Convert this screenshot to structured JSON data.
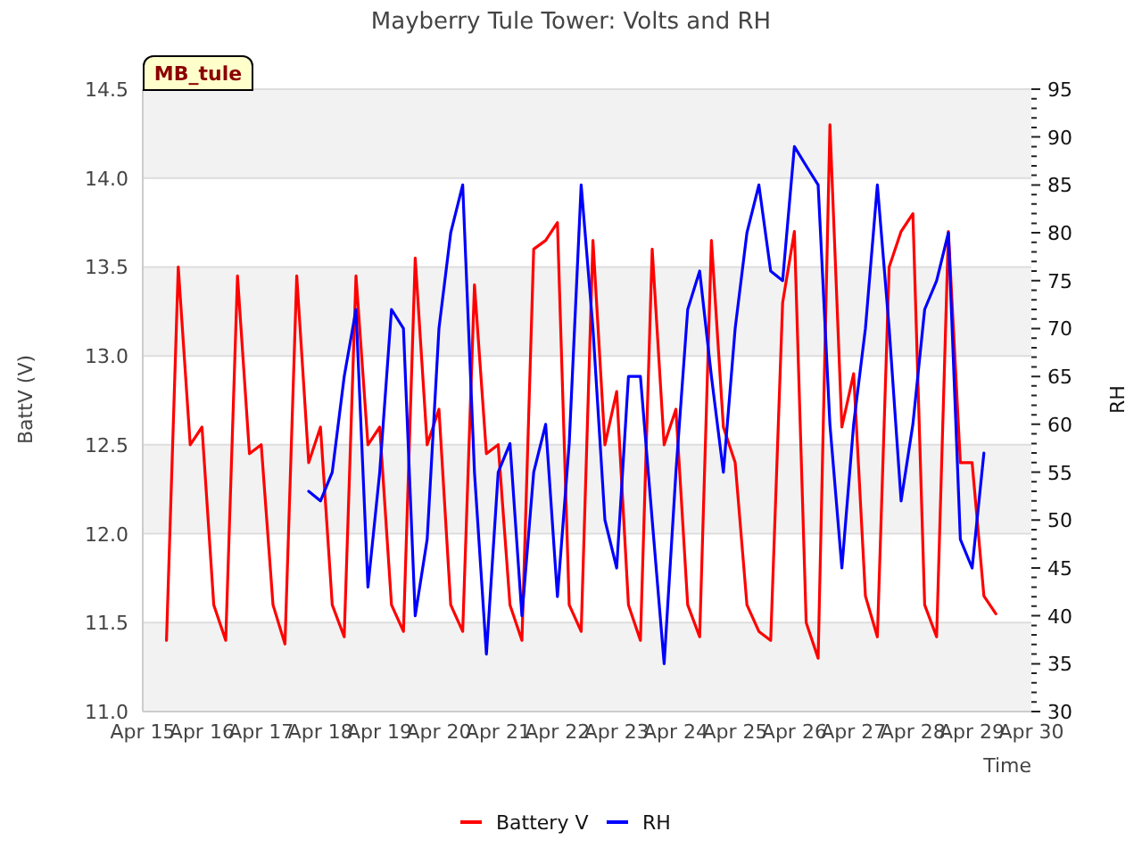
{
  "chart_data": {
    "type": "line",
    "title": "Mayberry Tule Tower: Volts and RH",
    "xlabel": "Time",
    "ylabel": "BattV (V)",
    "y2label": "RH",
    "ylim": [
      11,
      14.5
    ],
    "y2lim": [
      30,
      95
    ],
    "categories": [
      "Apr 15",
      null,
      null,
      null,
      null,
      "Apr 16",
      null,
      null,
      null,
      null,
      "Apr 17",
      null,
      null,
      null,
      null,
      "Apr 18",
      null,
      null,
      null,
      null,
      "Apr 19",
      null,
      null,
      null,
      null,
      "Apr 20",
      null,
      null,
      null,
      null,
      "Apr 21",
      null,
      null,
      null,
      null,
      "Apr 22",
      null,
      null,
      null,
      null,
      "Apr 23",
      null,
      null,
      null,
      null,
      "Apr 24",
      null,
      null,
      null,
      null,
      "Apr 25",
      null,
      null,
      null,
      null,
      "Apr 26",
      null,
      null,
      null,
      null,
      "Apr 27",
      null,
      null,
      null,
      null,
      "Apr 28",
      null,
      null,
      null,
      null,
      "Apr 29",
      null,
      null,
      null,
      null,
      "Apr 30"
    ],
    "yticks": [
      {
        "value": 11,
        "label": "11.0"
      },
      {
        "value": 11.5,
        "label": "11.5"
      },
      {
        "value": 12,
        "label": "12.0"
      },
      {
        "value": 12.5,
        "label": "12.5"
      },
      {
        "value": 13,
        "label": "13.0"
      },
      {
        "value": 13.5,
        "label": "13.5"
      },
      {
        "value": 14,
        "label": "14.0"
      },
      {
        "value": 14.5,
        "label": "14.5"
      }
    ],
    "y2ticks": [
      30,
      35,
      40,
      45,
      50,
      55,
      60,
      65,
      70,
      75,
      80,
      85,
      90,
      95
    ],
    "grid": true,
    "legend": "bottom",
    "series": [
      {
        "name": "Battery V",
        "color": "#ff0000",
        "values": [
          null,
          null,
          11.4,
          13.5,
          12.5,
          12.6,
          11.6,
          11.4,
          13.45,
          12.45,
          12.5,
          11.6,
          11.38,
          13.45,
          12.4,
          12.6,
          11.6,
          11.42,
          13.45,
          12.5,
          12.6,
          11.6,
          11.45,
          13.55,
          12.5,
          12.7,
          11.6,
          11.45,
          13.4,
          12.45,
          12.5,
          11.6,
          11.4,
          13.6,
          13.65,
          13.75,
          11.6,
          11.45,
          13.65,
          12.5,
          12.8,
          11.6,
          11.4,
          13.6,
          12.5,
          12.7,
          11.6,
          11.42,
          13.65,
          12.6,
          12.4,
          11.6,
          11.45,
          11.4,
          13.3,
          13.7,
          11.5,
          11.3,
          14.3,
          12.6,
          12.9,
          11.65,
          11.42,
          13.5,
          13.7,
          13.8,
          11.6,
          11.42,
          13.7,
          12.4,
          12.4,
          11.65,
          11.55,
          null,
          null,
          null
        ]
      },
      {
        "name": "RH",
        "color": "#0000ff",
        "axis": "y2",
        "values": [
          null,
          null,
          null,
          null,
          null,
          null,
          null,
          null,
          null,
          null,
          null,
          null,
          null,
          null,
          53,
          52,
          55,
          65,
          72,
          43,
          55,
          72,
          70,
          40,
          48,
          70,
          80,
          85,
          55,
          36,
          55,
          58,
          40,
          55,
          60,
          42,
          58,
          85,
          70,
          50,
          45,
          65,
          65,
          50,
          35,
          55,
          72,
          76,
          65,
          55,
          70,
          80,
          85,
          76,
          75,
          89,
          87,
          85,
          60,
          45,
          60,
          70,
          85,
          70,
          52,
          60,
          72,
          75,
          80,
          48,
          45,
          57,
          null,
          null,
          null,
          null
        ]
      }
    ],
    "annotations": [
      {
        "text": "MB_tule"
      }
    ]
  }
}
